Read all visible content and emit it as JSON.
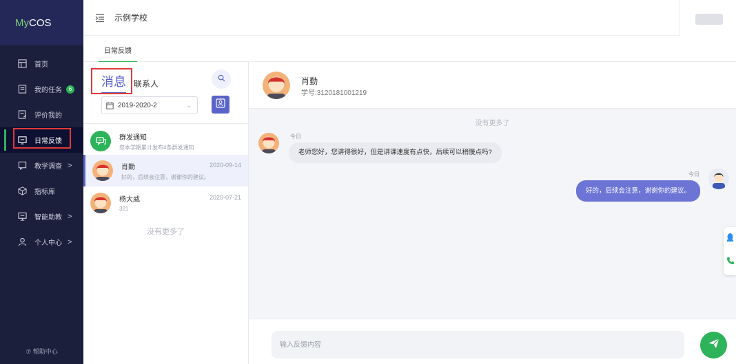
{
  "app": {
    "logo_my": "My",
    "logo_cos": "COS"
  },
  "topbar": {
    "school": "示例学校"
  },
  "sidebar": {
    "items": [
      {
        "label": "首页",
        "icon": "layout-icon"
      },
      {
        "label": "我的任务",
        "icon": "task-list-icon",
        "badge": "6"
      },
      {
        "label": "评价我的",
        "icon": "evaluate-icon"
      },
      {
        "label": "日常反馈",
        "icon": "feedback-icon",
        "active": true
      },
      {
        "label": "教学调查",
        "icon": "survey-icon",
        "arrow": ">"
      },
      {
        "label": "指标库",
        "icon": "cube-icon"
      },
      {
        "label": "智能助教",
        "icon": "monitor-icon",
        "arrow": ">"
      },
      {
        "label": "个人中心",
        "icon": "user-icon",
        "arrow": ">"
      }
    ],
    "help": "⑦ 帮助中心"
  },
  "tabs": {
    "daily_feedback": "日常反馈"
  },
  "list": {
    "tab_message": "消息",
    "tab_contacts": "联系人",
    "term": "2019-2020-2",
    "conversations": [
      {
        "name": "群发通知",
        "preview": "您本学期累计发布4条群发通知",
        "date": ""
      },
      {
        "name": "肖勤",
        "preview": "好的，后续会注意，谢谢你的建议。",
        "date": "2020-09-14"
      },
      {
        "name": "杨大威",
        "preview": "321",
        "date": "2020-07-21"
      }
    ],
    "no_more": "没有更多了"
  },
  "chat": {
    "name": "肖勤",
    "student_id": "学号:3120181001219",
    "no_more": "没有更多了",
    "messages": [
      {
        "side": "left",
        "time": "今日",
        "text": "老师您好，您讲得很好，但是讲课速度有点快，后续可以稍慢点吗?"
      },
      {
        "side": "right",
        "time": "今日",
        "text": "好的，后续会注意，谢谢你的建议。"
      }
    ],
    "input_placeholder": "输入反馈内容"
  },
  "colors": {
    "sidebar_bg": "#1b1f3b",
    "accent_purple": "#5a63c8",
    "accent_green": "#2db35a",
    "highlight_red": "#e03a3a"
  }
}
